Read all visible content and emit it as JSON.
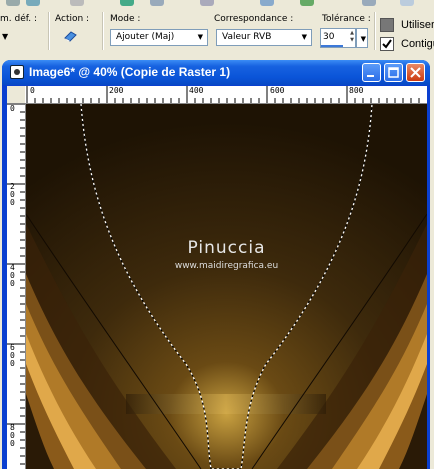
{
  "toolbar": {
    "preset_label": "m. déf. :",
    "action_label": "Action :",
    "mode_label": "Mode :",
    "mode_value": "Ajouter (Maj)",
    "match_label": "Correspondance :",
    "match_value": "Valeur RVB",
    "tolerance_label": "Tolérance :",
    "tolerance_value": "30",
    "use_all_label": "Utiliser",
    "contiguous_label": "Contigu"
  },
  "window": {
    "title": "Image6* @  40% (Copie de Raster 1)"
  },
  "ruler": {
    "top_ticks": [
      "0",
      "200",
      "400",
      "600",
      "800"
    ],
    "left_ticks": [
      "0",
      "200",
      "400",
      "600",
      "800"
    ]
  },
  "canvas": {
    "watermark_name": "Pinuccia",
    "watermark_url": "www.maidiregrafica.eu"
  },
  "colors": {
    "title_bar": "#0a54d8",
    "canvas_brown": "#4a2c0c",
    "canvas_gold": "#d8a040"
  }
}
